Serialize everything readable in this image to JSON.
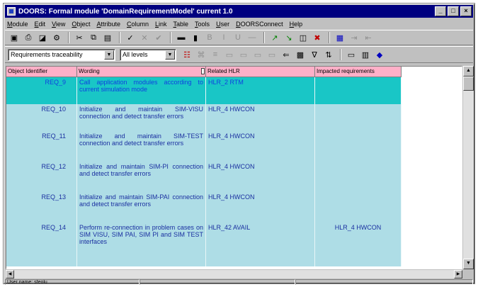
{
  "window": {
    "title": "DOORS: Formal module 'DomainRequirementModel' current 1.0",
    "minimize": "_",
    "maximize": "□",
    "close": "×"
  },
  "menu": [
    "Module",
    "Edit",
    "View",
    "Object",
    "Attribute",
    "Column",
    "Link",
    "Table",
    "Tools",
    "User",
    "DOORSConnect",
    "Help"
  ],
  "toolbar2": {
    "view_select": "Requirements traceability",
    "level_select": "All levels"
  },
  "table": {
    "headers": [
      "Object Identifier",
      "Wording",
      "Related HLR",
      "Impacted requirements"
    ],
    "rows": [
      {
        "id": "REQ_9",
        "wording": "Call application modules according to current simulation mode",
        "hlr": "HLR_2 RTM",
        "impacted": "",
        "selected": true
      },
      {
        "id": "REQ_10",
        "wording": "Initialize and maintain SIM-VISU connection and detect transfer errors",
        "hlr": "HLR_4 HWCON",
        "impacted": ""
      },
      {
        "id": "REQ_11",
        "wording": "Initialize and maintain SIM-TEST connection and detect transfer errors",
        "hlr": "HLR_4 HWCON",
        "impacted": ""
      },
      {
        "id": "REQ_12",
        "wording": "Initialize and maintain SIM-PI connection and detect transfer errors",
        "hlr": "HLR_4 HWCON",
        "impacted": ""
      },
      {
        "id": "REQ_13",
        "wording": "Initialize and maintain SIM-PAI connection and detect transfer errors",
        "hlr": "HLR_4 HWCON",
        "impacted": ""
      },
      {
        "id": "REQ_14",
        "wording": "Perform re-connection in problem cases on SIM VISU, SIM PAI, SIM PI and SIM TEST interfaces",
        "hlr": "HLR_42 AVAIL",
        "impacted": "HLR_4 HWCON"
      }
    ]
  },
  "status": {
    "user": "User name: sfeolu"
  },
  "colors": {
    "titlebar": "#000080",
    "header": "#ffb0c8",
    "row": "#aedde6",
    "row_selected": "#19c6c6",
    "text": "#1a2fa0"
  }
}
